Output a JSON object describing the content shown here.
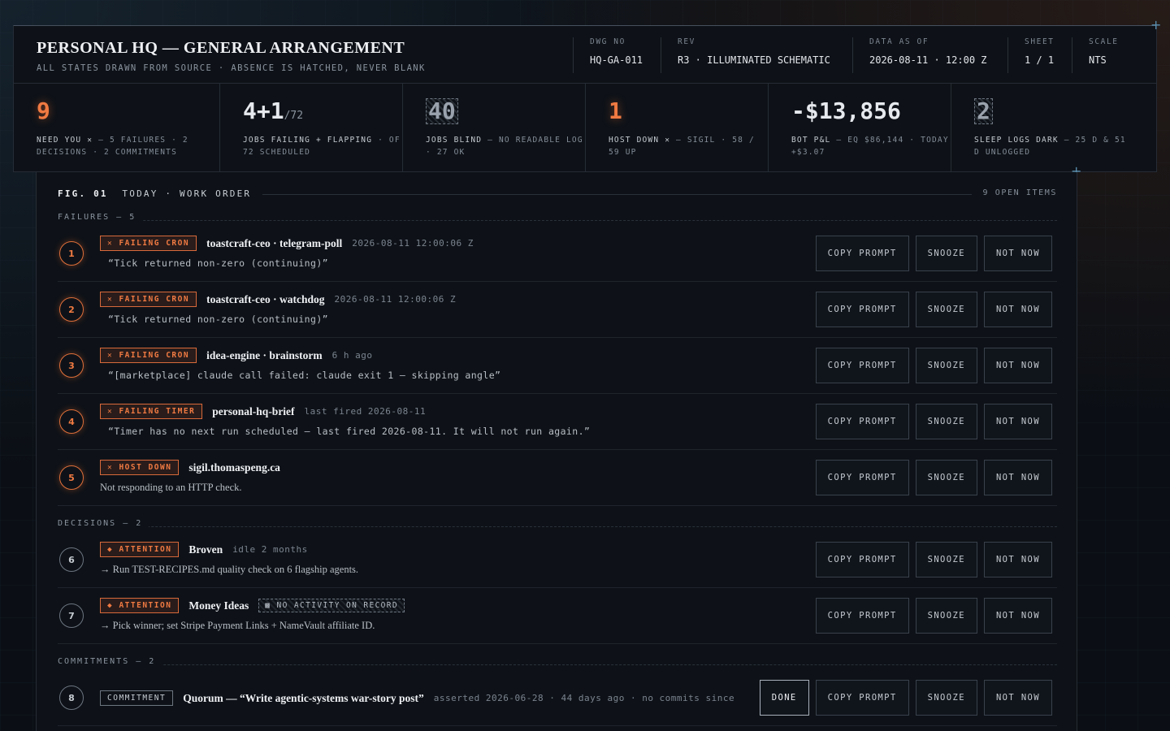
{
  "header": {
    "title": "PERSONAL HQ — GENERAL ARRANGEMENT",
    "subtitle": "ALL STATES DRAWN FROM SOURCE · ABSENCE IS HATCHED, NEVER BLANK",
    "meta": [
      {
        "label": "DWG NO",
        "value": "HQ-GA-011"
      },
      {
        "label": "REV",
        "value": "R3 · ILLUMINATED SCHEMATIC"
      },
      {
        "label": "DATA AS OF",
        "value": "2026-08-11 · 12:00 Z"
      },
      {
        "label": "SHEET",
        "value": "1 / 1"
      },
      {
        "label": "SCALE",
        "value": "NTS"
      }
    ]
  },
  "kpis": [
    {
      "value": "9",
      "desc_strong": "NEED YOU ✕",
      "desc": " — 5 FAILURES · 2 DECISIONS · 2 COMMITMENTS"
    },
    {
      "value": "4+1",
      "suffix": "/72",
      "desc_strong": "JOBS FAILING + FLAPPING",
      "desc": " · OF 72 SCHEDULED"
    },
    {
      "value": "40",
      "desc_strong": "JOBS BLIND",
      "desc": " — NO READABLE LOG · 27 OK"
    },
    {
      "value": "1",
      "desc_strong": "HOST DOWN ✕",
      "desc": " — SIGIL · 58 / 59 UP"
    },
    {
      "value": "-$13,856",
      "desc_strong": "BOT P&L",
      "desc": " — EQ $86,144 · TODAY +$3.07"
    },
    {
      "value": "2",
      "desc_strong": "SLEEP LOGS DARK",
      "desc": " — 25 D & 51 D UNLOGGED"
    }
  ],
  "figure": {
    "label_prefix": "FIG. 01",
    "label": "TODAY · WORK ORDER",
    "count": "9 OPEN ITEMS"
  },
  "sections": {
    "failures": "FAILURES  — 5",
    "decisions": "DECISIONS  — 2",
    "commitments": "COMMITMENTS  — 2"
  },
  "buttons": {
    "copy": "COPY PROMPT",
    "snooze": "SNOOZE",
    "notnow": "NOT NOW",
    "done": "DONE"
  },
  "items": [
    {
      "num": "1",
      "badge": "✕ FAILING CRON",
      "title": "toastcraft-ceo · telegram-poll",
      "meta": "2026-08-11 12:00:06 Z",
      "detail": "“Tick returned non-zero (continuing)”"
    },
    {
      "num": "2",
      "badge": "✕ FAILING CRON",
      "title": "toastcraft-ceo · watchdog",
      "meta": "2026-08-11 12:00:06 Z",
      "detail": "“Tick returned non-zero (continuing)”"
    },
    {
      "num": "3",
      "badge": "✕ FAILING CRON",
      "title": "idea-engine · brainstorm",
      "meta": "6 h ago",
      "detail": "“[marketplace] claude call failed: claude exit 1 — skipping angle”"
    },
    {
      "num": "4",
      "badge": "✕ FAILING TIMER",
      "title": "personal-hq-brief",
      "meta": "last fired 2026-08-11",
      "detail": "“Timer has no next run scheduled — last fired 2026-08-11. It will not run again.”"
    },
    {
      "num": "5",
      "badge": "✕ HOST DOWN",
      "title": "sigil.thomaspeng.ca",
      "meta": "",
      "detail": "Not responding to an HTTP check."
    },
    {
      "num": "6",
      "badge": "◆ ATTENTION",
      "title": "Broven",
      "meta": "idle 2 months",
      "detail": "→ Run TEST-RECIPES.md quality check on 6 flagship agents."
    },
    {
      "num": "7",
      "badge": "◆ ATTENTION",
      "title": "Money Ideas",
      "meta": "",
      "noact": "▩ NO ACTIVITY ON RECORD",
      "detail": "→ Pick winner; set Stripe Payment Links + NameVault affiliate ID."
    },
    {
      "num": "8",
      "badge": "COMMITMENT",
      "title": "Quorum — “Write agentic-systems war-story post”",
      "meta": "asserted 2026-06-28 · 44 days ago · no commits since"
    }
  ],
  "colors": {
    "accent": "#f07a42",
    "background": "#0b0f15",
    "panel": "#0e1218"
  }
}
